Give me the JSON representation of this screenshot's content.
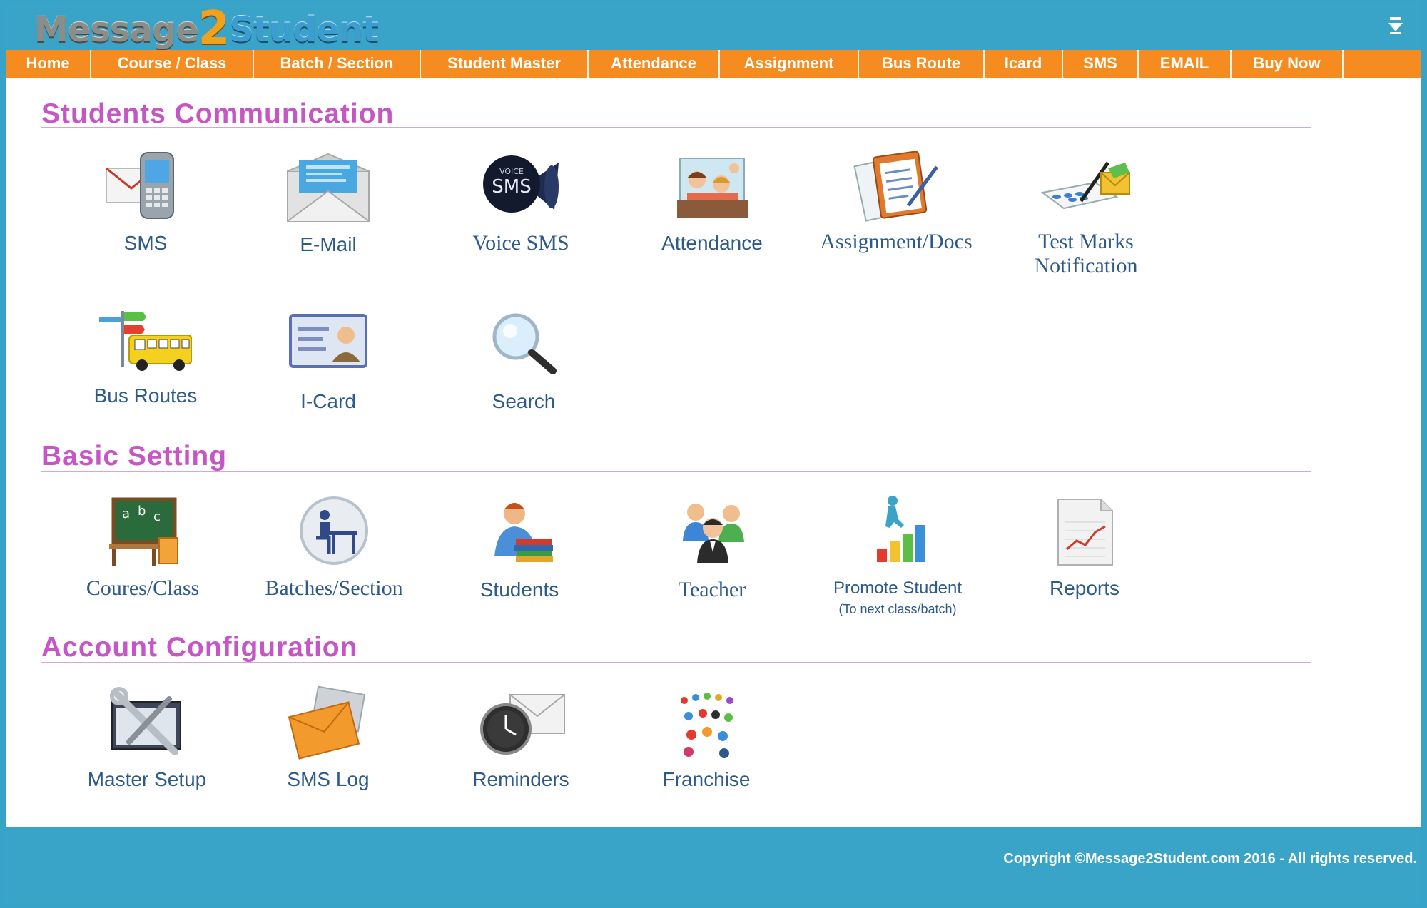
{
  "brand": {
    "part1": "Message",
    "part2": "2",
    "part3": "Student"
  },
  "header": {
    "download_icon": "download-arrow-icon"
  },
  "nav": [
    "Home",
    "Course / Class",
    "Batch / Section",
    "Student Master",
    "Attendance",
    "Assignment",
    "Bus Route",
    "Icard",
    "SMS",
    "EMAIL",
    "Buy Now"
  ],
  "sections": {
    "communication": {
      "title": "Students Communication",
      "items": [
        {
          "label": "SMS",
          "icon": "sms-phone-icon"
        },
        {
          "label": "E-Mail",
          "icon": "envelope-icon"
        },
        {
          "label": "Voice SMS",
          "icon": "voice-sms-icon"
        },
        {
          "label": "Attendance",
          "icon": "classroom-icon"
        },
        {
          "label": "Assignment/Docs",
          "icon": "clipboard-icon"
        },
        {
          "label": "Test Marks",
          "label2": "Notification",
          "icon": "test-marks-icon"
        },
        {
          "label": "Bus Routes",
          "icon": "school-bus-icon"
        },
        {
          "label": "I-Card",
          "icon": "id-card-icon"
        },
        {
          "label": "Search",
          "icon": "magnifier-icon"
        }
      ]
    },
    "basic": {
      "title": "Basic Setting",
      "items": [
        {
          "label": "Coures/Class",
          "icon": "chalkboard-icon"
        },
        {
          "label": "Batches/Section",
          "icon": "desk-icon"
        },
        {
          "label": "Students",
          "icon": "student-books-icon"
        },
        {
          "label": "Teacher",
          "icon": "teacher-group-icon"
        },
        {
          "label": "Promote Student",
          "sub": "(To next class/batch)",
          "icon": "promote-chart-icon"
        },
        {
          "label": "Reports",
          "icon": "report-icon"
        }
      ]
    },
    "account": {
      "title": "Account Configuration",
      "items": [
        {
          "label": "Master Setup",
          "icon": "tools-icon"
        },
        {
          "label": "SMS Log",
          "icon": "mail-log-icon"
        },
        {
          "label": "Reminders",
          "icon": "clock-mail-icon"
        },
        {
          "label": "Franchise",
          "icon": "network-people-icon"
        }
      ]
    }
  },
  "footer": {
    "copyright": "Copyright ©Message2Student.com 2016 - All rights reserved."
  },
  "colors": {
    "header": "#3aa3c8",
    "nav": "#f68c1f",
    "section_title": "#c655c6",
    "label": "#2e5a8a"
  }
}
